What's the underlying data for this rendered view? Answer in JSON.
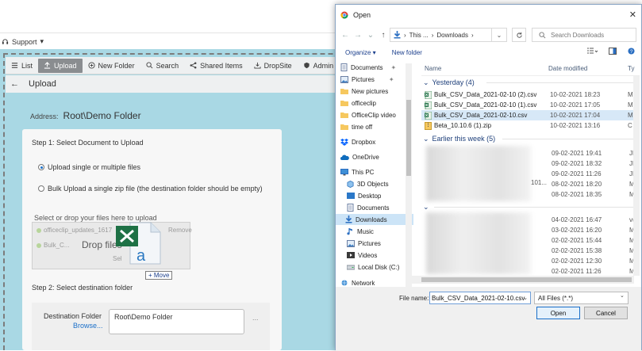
{
  "app": {
    "support_label": "Support",
    "toolbar": [
      {
        "label": "List",
        "icon": "list-icon",
        "active": false
      },
      {
        "label": "Upload",
        "icon": "upload-icon",
        "active": true
      },
      {
        "label": "New Folder",
        "icon": "add-folder-icon",
        "active": false
      },
      {
        "label": "Search",
        "icon": "search-icon",
        "active": false
      },
      {
        "label": "Shared Items",
        "icon": "share-icon",
        "active": false
      },
      {
        "label": "DropSite",
        "icon": "dropsite-icon",
        "active": false
      },
      {
        "label": "Admin",
        "icon": "shield-icon",
        "active": false
      }
    ],
    "page_title": "Upload",
    "address_label": "Address:",
    "address_value": "Root\\Demo Folder",
    "step1_label": "Step 1: Select Document to Upload",
    "radio_single": "Upload single or multiple files",
    "radio_zip": "Bulk Upload a single zip file (the destination folder should be empty)",
    "drop_caption": "Select or drop your files here to upload",
    "ghost_file_1": "officeclip_updates_1617",
    "ghost_remove": "Remove",
    "ghost_file_2": "Bulk_C...",
    "ghost_select": "Sel",
    "drop_files_label": "Drop files",
    "move_tooltip": "+ Move",
    "step2_label": "Step 2: Select destination folder",
    "dest_label": "Destination Folder",
    "browse_label": "Browse...",
    "dest_value": "Root\\Demo Folder",
    "dest_dots": "..."
  },
  "dialog": {
    "title": "Open",
    "close": "✕",
    "crumbs": [
      "This ...",
      "Downloads"
    ],
    "search_placeholder": "Search Downloads",
    "organize": "Organize ▾",
    "new_folder": "New folder",
    "nav_items": [
      {
        "label": "Documents",
        "icon": "documents-icon",
        "pinned": true
      },
      {
        "label": "Pictures",
        "icon": "pictures-icon",
        "pinned": true
      },
      {
        "label": "New pictures",
        "icon": "folder-icon",
        "pinned": false
      },
      {
        "label": "officeclip",
        "icon": "folder-icon",
        "pinned": false
      },
      {
        "label": "OfficeClip video",
        "icon": "folder-icon",
        "pinned": false
      },
      {
        "label": "time off",
        "icon": "folder-icon",
        "pinned": false
      },
      {
        "label": "Dropbox",
        "icon": "dropbox-icon",
        "pinned": false
      },
      {
        "label": "OneDrive",
        "icon": "onedrive-icon",
        "pinned": false
      },
      {
        "label": "This PC",
        "icon": "pc-icon",
        "pinned": false
      },
      {
        "label": "3D Objects",
        "icon": "cube-icon",
        "pinned": false
      },
      {
        "label": "Desktop",
        "icon": "desktop-icon",
        "pinned": false
      },
      {
        "label": "Documents",
        "icon": "documents-icon",
        "pinned": false
      },
      {
        "label": "Downloads",
        "icon": "downloads-icon",
        "pinned": false
      },
      {
        "label": "Music",
        "icon": "music-icon",
        "pinned": false
      },
      {
        "label": "Pictures",
        "icon": "pictures-icon",
        "pinned": false
      },
      {
        "label": "Videos",
        "icon": "videos-icon",
        "pinned": false
      },
      {
        "label": "Local Disk (C:)",
        "icon": "disk-icon",
        "pinned": false
      },
      {
        "label": "Network",
        "icon": "network-icon",
        "pinned": false
      }
    ],
    "columns": {
      "name": "Name",
      "date": "Date modified",
      "type": "Ty"
    },
    "group_yesterday": "Yesterday (4)",
    "files_yesterday": [
      {
        "name": "Bulk_CSV_Data_2021-02-10 (2).csv",
        "date": "10-02-2021 18:23",
        "type": "M",
        "icon": "excel-icon"
      },
      {
        "name": "Bulk_CSV_Data_2021-02-10 (1).csv",
        "date": "10-02-2021 17:05",
        "type": "M",
        "icon": "excel-icon"
      },
      {
        "name": "Bulk_CSV_Data_2021-02-10.csv",
        "date": "10-02-2021 17:04",
        "type": "M",
        "icon": "excel-icon"
      },
      {
        "name": "Beta_10.10.6 (1).zip",
        "date": "10-02-2021 13:16",
        "type": "C",
        "icon": "zip-icon"
      }
    ],
    "group_earlier": "Earlier this week (5)",
    "dates_earlier": [
      {
        "date": "09-02-2021 19:41",
        "type": "JP"
      },
      {
        "date": "09-02-2021 18:32",
        "type": "JP"
      },
      {
        "date": "09-02-2021 11:26",
        "type": "JP"
      },
      {
        "date": "08-02-2021 18:20",
        "type": "M"
      },
      {
        "date": "08-02-2021 18:35",
        "type": "M"
      }
    ],
    "partial_101": "101...",
    "dates_last": [
      {
        "date": "04-02-2021 16:47",
        "type": "v("
      },
      {
        "date": "03-02-2021 16:20",
        "type": "M"
      },
      {
        "date": "02-02-2021 15:44",
        "type": "M"
      },
      {
        "date": "02-02-2021 15:38",
        "type": "M"
      },
      {
        "date": "02-02-2021 12:30",
        "type": "M"
      },
      {
        "date": "02-02-2021 11:26",
        "type": "M"
      }
    ],
    "filename_label": "File name:",
    "filename_value": "Bulk_CSV_Data_2021-02-10.csv",
    "filetype_value": "All Files (*.*)",
    "open_button": "Open",
    "cancel_button": "Cancel"
  },
  "colors": {
    "app_background": "#a9d8e4",
    "accent": "#1a6fc9",
    "selected_row": "#d7e8f7"
  }
}
